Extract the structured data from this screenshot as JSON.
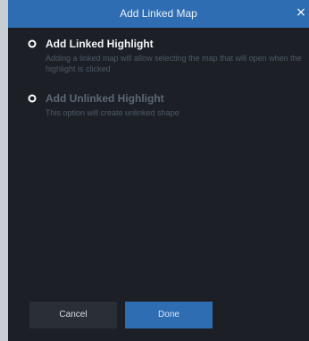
{
  "dialog": {
    "title": "Add Linked Map",
    "close_label": "×",
    "options": [
      {
        "title": "Add Linked Highlight",
        "description": "Adding a linked map will allow selecting the map that will open when the highlight is clicked",
        "selected": true
      },
      {
        "title": "Add Unlinked Highlight",
        "description": "This option will create unlinked shape",
        "selected": false
      }
    ],
    "cancel_label": "Cancel",
    "done_label": "Done"
  },
  "colors": {
    "background": "#1c2026",
    "titlebar": "#2f6db3",
    "primary_button": "#2f6db3",
    "secondary_button": "#2a2e35"
  }
}
